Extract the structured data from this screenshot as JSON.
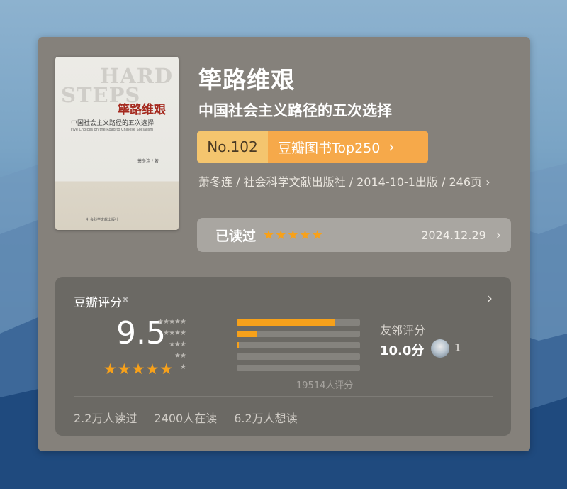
{
  "book": {
    "title": "筚路维艰",
    "subtitle": "中国社会主义路径的五次选择",
    "cover": {
      "en_line1": "HARD",
      "en_line2": "STEPS",
      "title_zh": "筚路维艰",
      "subtitle_zh": "中国社会主义路径的五次选择",
      "subtitle_en": "Five Choices on the Road to Chinese Socialism",
      "author": "萧冬连 / 著",
      "publisher": "社会科学文献出版社"
    },
    "rank": {
      "number": "No.102",
      "list_label": "豆瓣图书Top250",
      "chevron": "›"
    },
    "meta": "萧冬连 / 社会科学文献出版社 / 2014-10-1出版 / 246页 ›"
  },
  "read_status": {
    "label": "已读过",
    "stars": "★★★★★",
    "date": "2024.12.29",
    "chevron": "›"
  },
  "rating": {
    "heading": "豆瓣评分",
    "reg_mark": "®",
    "chevron": "›",
    "score": "9.5",
    "stars": "★★★★★",
    "distribution": [
      {
        "stars": "★★★★★",
        "fraction": 0.8
      },
      {
        "stars": "★★★★",
        "fraction": 0.16
      },
      {
        "stars": "★★★",
        "fraction": 0.02
      },
      {
        "stars": "★★",
        "fraction": 0.005
      },
      {
        "stars": "★",
        "fraction": 0.005
      }
    ],
    "count": "19514人评分",
    "friends": {
      "label": "友邻评分",
      "score": "10.0分",
      "count": "1"
    }
  },
  "stats": {
    "read": "2.2万人读过",
    "reading": "2400人在读",
    "want": "6.2万人想读"
  },
  "colors": {
    "accent_orange": "#f7a11a",
    "rank_light": "#f4c56e",
    "rank_dark": "#f6a94a",
    "card_bg": "#85817b"
  }
}
